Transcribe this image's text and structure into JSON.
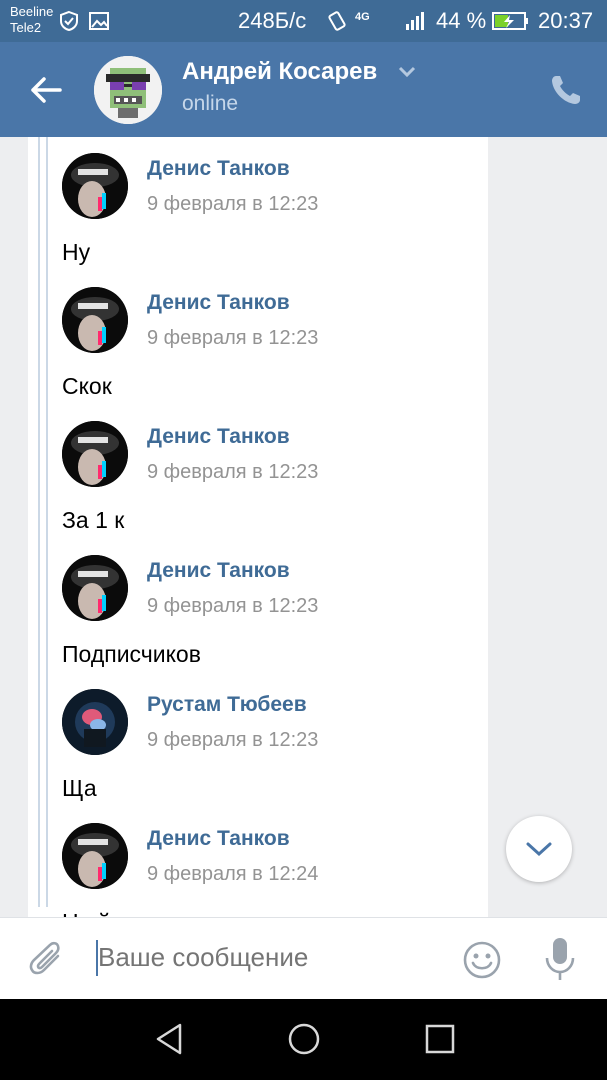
{
  "status_bar": {
    "carrier1": "Beeline",
    "carrier2": "Tele2",
    "speed": "248Б/с",
    "network": "4G",
    "battery": "44 %",
    "time": "20:37"
  },
  "header": {
    "title": "Андрей Косарев",
    "status": "online",
    "back_icon": "arrow-left-icon",
    "call_icon": "phone-icon"
  },
  "messages": [
    {
      "name": "Денис Танков",
      "time": "9 февраля в 12:23",
      "text": "Ну"
    },
    {
      "name": "Денис Танков",
      "time": "9 февраля в 12:23",
      "text": "Скок"
    },
    {
      "name": "Денис Танков",
      "time": "9 февраля в 12:23",
      "text": "За 1 к"
    },
    {
      "name": "Денис Танков",
      "time": "9 февраля в 12:23",
      "text": "Подписчиков"
    },
    {
      "name": "Рустам Тюбеев",
      "time": "9 февраля в 12:23",
      "text": "Ща"
    },
    {
      "name": "Денис Танков",
      "time": "9 февраля в 12:24",
      "text": "Н...й"
    }
  ],
  "composer": {
    "placeholder": "Ваше сообщение"
  },
  "colors": {
    "header": "#4a76a8",
    "statusbar": "#3f6b96",
    "name": "#3f6b96",
    "time": "#939393"
  }
}
